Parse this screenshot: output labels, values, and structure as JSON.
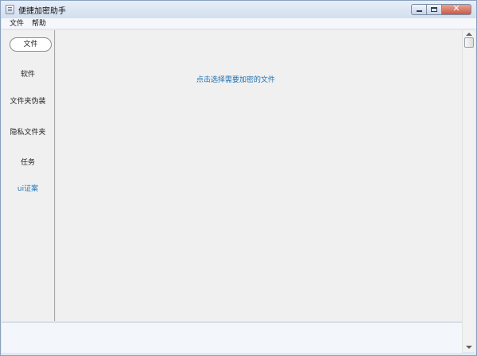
{
  "window": {
    "title": "便捷加密助手",
    "icon": "app-document-icon",
    "controls": {
      "minimize_icon": "minimize-icon",
      "maximize_icon": "maximize-icon",
      "close_icon": "close-icon",
      "close_glyph": "✕"
    }
  },
  "menu": {
    "items": [
      {
        "label": "文件"
      },
      {
        "label": "帮助"
      }
    ]
  },
  "sidebar": {
    "items": [
      {
        "label": "文件",
        "active": true
      },
      {
        "label": "软件",
        "active": false
      },
      {
        "label": "文件夹伪装",
        "active": false
      },
      {
        "label": "隐私文件夹",
        "active": false
      },
      {
        "label": "任务",
        "active": false
      },
      {
        "label": "ui证案",
        "active": false,
        "link": true
      }
    ]
  },
  "main": {
    "prompt": "点击选择需要加密的文件",
    "link_color": "#1d6fb0"
  },
  "colors": {
    "accent": "#2a78b8",
    "panel_bg": "#f0f0f0"
  }
}
